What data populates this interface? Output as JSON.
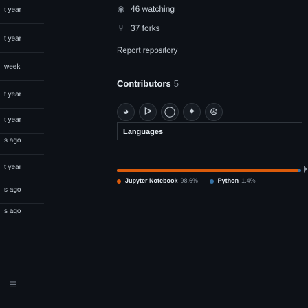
{
  "left_rows": [
    {
      "text": "t year"
    },
    {
      "text": "t year"
    },
    {
      "text": "week"
    },
    {
      "text": "t year"
    },
    {
      "text": "t year"
    },
    {
      "text": "s ago"
    },
    {
      "text": "t year"
    },
    {
      "text": "s ago"
    },
    {
      "text": "s ago"
    }
  ],
  "menu_icon": "list-icon",
  "stats": {
    "watching": "46 watching",
    "forks": "37 forks"
  },
  "report": "Report repository",
  "contributors": {
    "title": "Contributors",
    "count": "5"
  },
  "avatars": [
    {
      "glyph": "◕",
      "icon": "avatar-icon"
    },
    {
      "glyph": "ᐅ",
      "icon": "avatar-icon"
    },
    {
      "glyph": "◯",
      "icon": "avatar-icon"
    },
    {
      "glyph": "✦",
      "icon": "avatar-icon"
    },
    {
      "glyph": "⊛",
      "icon": "avatar-icon"
    }
  ],
  "languages": {
    "title": "Languages",
    "items": [
      {
        "name": "Jupyter Notebook",
        "percent": "98.6%",
        "value": 98.6,
        "color": "#DA5B0B"
      },
      {
        "name": "Python",
        "percent": "1.4%",
        "value": 1.4,
        "color": "#3572A5"
      }
    ]
  }
}
